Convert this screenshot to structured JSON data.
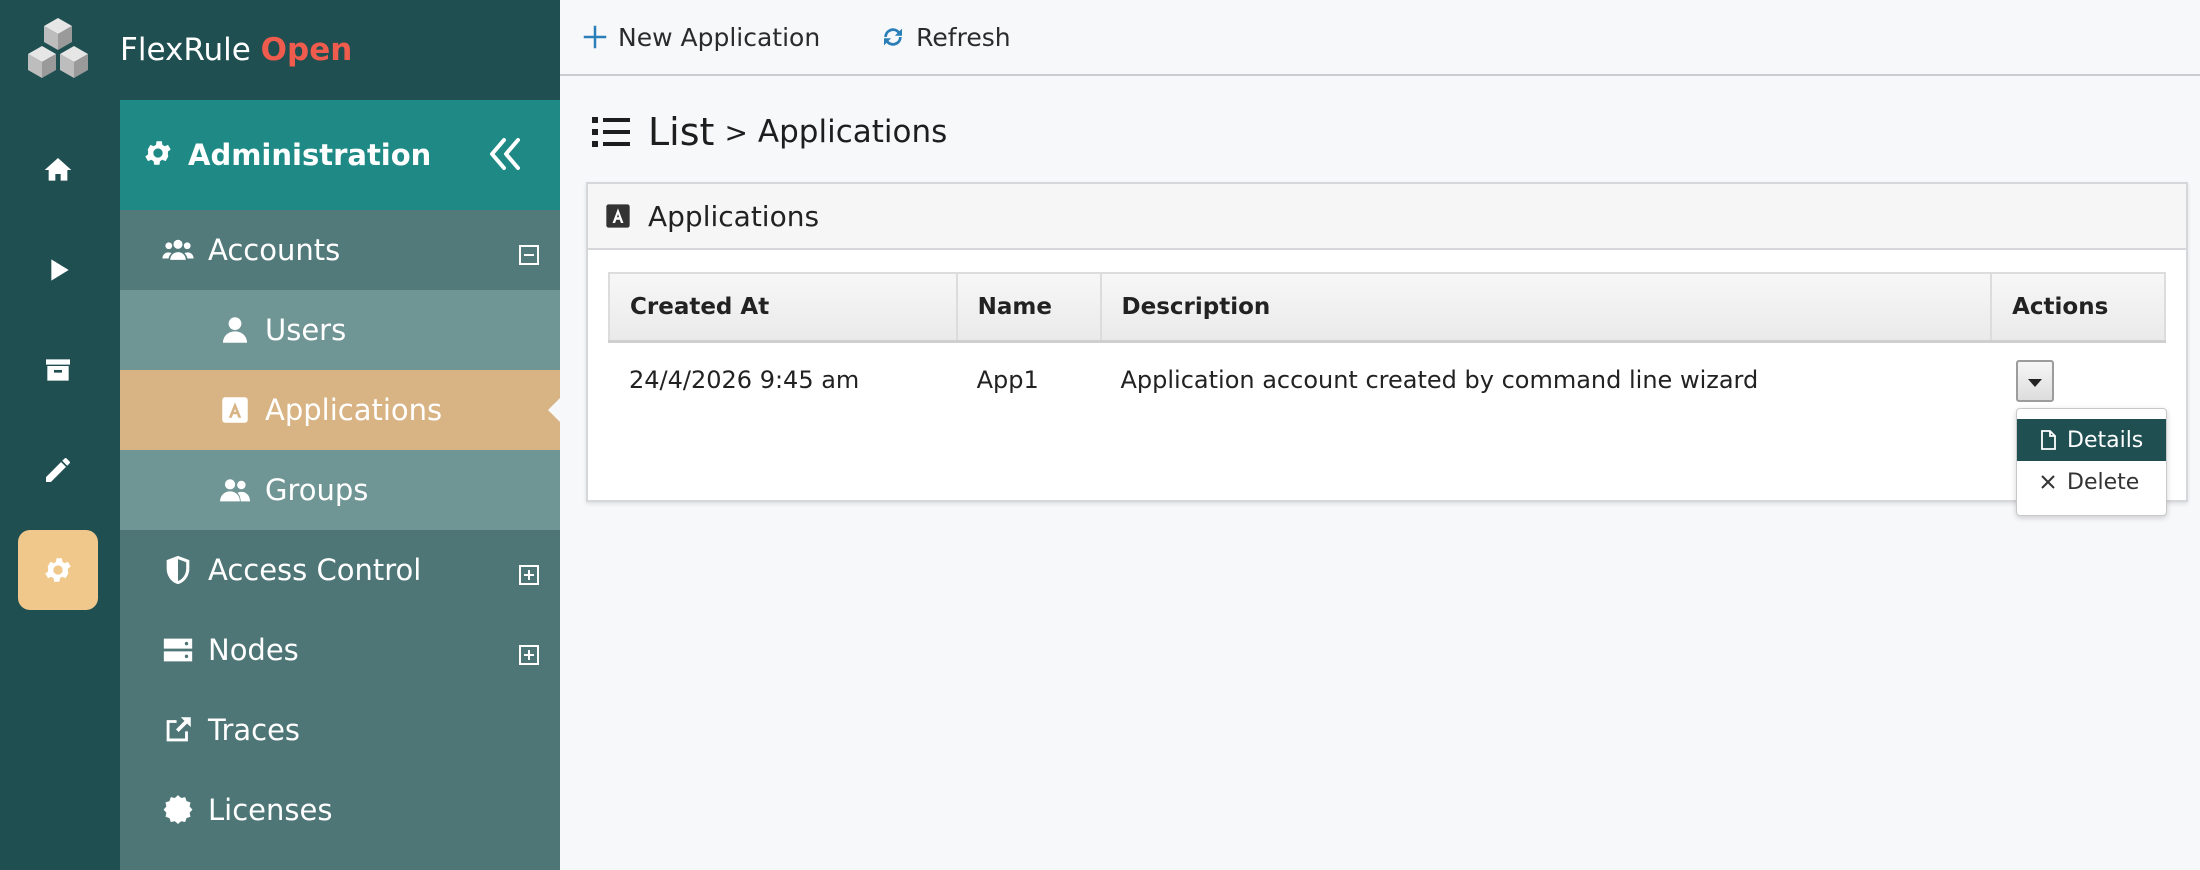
{
  "brand": {
    "name": "FlexRule",
    "edition": "Open"
  },
  "rail": {
    "items": [
      {
        "icon": "home-icon"
      },
      {
        "icon": "play-icon"
      },
      {
        "icon": "archive-icon"
      },
      {
        "icon": "pencil-icon"
      },
      {
        "icon": "gear-icon",
        "active": true
      }
    ]
  },
  "sidebar": {
    "title": "Administration",
    "items": [
      {
        "label": "Accounts",
        "icon": "users-icon",
        "expanded": true
      },
      {
        "label": "Users",
        "icon": "user-icon"
      },
      {
        "label": "Applications",
        "icon": "app-icon",
        "selected": true
      },
      {
        "label": "Groups",
        "icon": "group-icon"
      },
      {
        "label": "Access Control",
        "icon": "shield-icon",
        "expanded": false
      },
      {
        "label": "Nodes",
        "icon": "server-icon",
        "expanded": false
      },
      {
        "label": "Traces",
        "icon": "external-link-icon"
      },
      {
        "label": "Licenses",
        "icon": "certificate-icon"
      }
    ]
  },
  "toolbar": {
    "new_label": "New Application",
    "refresh_label": "Refresh"
  },
  "page": {
    "title": "List",
    "separator": ">",
    "subtitle": "Applications"
  },
  "panel": {
    "title": "Applications",
    "columns": [
      "Created At",
      "Name",
      "Description",
      "Actions"
    ],
    "rows": [
      {
        "created_at": "24/4/2026 9:45 am",
        "name": "App1",
        "description": "Application account created by command line wizard"
      }
    ]
  },
  "actions_menu": {
    "details_label": "Details",
    "delete_label": "Delete"
  },
  "colors": {
    "rail": "#1f4f51",
    "sidebar": "#4e7677",
    "sidebar_header": "#1f8a85",
    "selected_item": "#d8b383",
    "accent_open": "#ef5b4c",
    "active_rail": "#f1c88b"
  }
}
